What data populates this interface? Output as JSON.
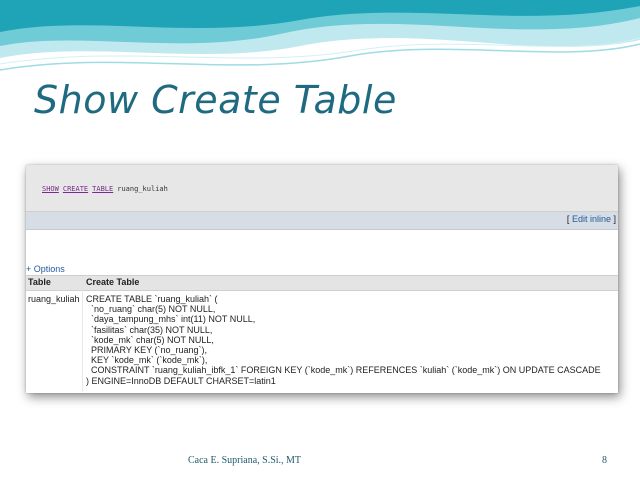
{
  "slide": {
    "title": "Show Create Table",
    "footer_author": "Caca E. Supriana, S.Si., MT",
    "page_number": "8",
    "colors": {
      "title": "#1f6a80",
      "wave_dark": "#1fa3b6",
      "wave_light": "#bfe9ee"
    }
  },
  "query": {
    "keywords": [
      "SHOW",
      "CREATE",
      "TABLE"
    ],
    "table_name": "ruang_kuliah"
  },
  "edit_bar": {
    "open_bracket": "[",
    "link_label": "Edit inline",
    "close_bracket": "]"
  },
  "options_label": "+ Options",
  "result": {
    "headers": [
      "Table",
      "Create Table"
    ],
    "row": {
      "table": "ruang_kuliah",
      "create_lines": [
        "CREATE TABLE `ruang_kuliah` (",
        "  `no_ruang` char(5) NOT NULL,",
        "  `daya_tampung_mhs` int(11) NOT NULL,",
        "  `fasilitas` char(35) NOT NULL,",
        "  `kode_mk` char(5) NOT NULL,",
        "  PRIMARY KEY (`no_ruang`),",
        "  KEY `kode_mk` (`kode_mk`),",
        "  CONSTRAINT `ruang_kuliah_ibfk_1` FOREIGN KEY (`kode_mk`) REFERENCES `kuliah` (`kode_mk`) ON UPDATE CASCADE",
        ") ENGINE=InnoDB DEFAULT CHARSET=latin1"
      ]
    }
  }
}
